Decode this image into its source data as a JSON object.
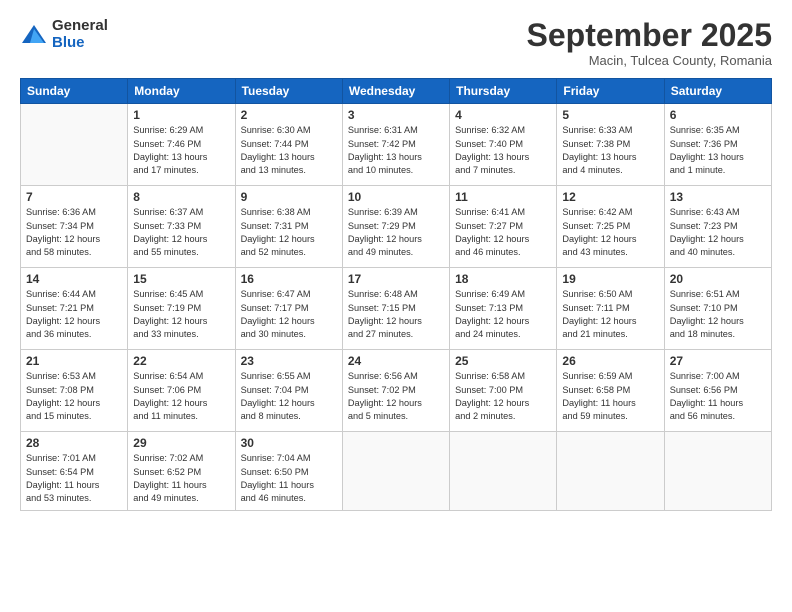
{
  "logo": {
    "general": "General",
    "blue": "Blue"
  },
  "header": {
    "month": "September 2025",
    "location": "Macin, Tulcea County, Romania"
  },
  "weekdays": [
    "Sunday",
    "Monday",
    "Tuesday",
    "Wednesday",
    "Thursday",
    "Friday",
    "Saturday"
  ],
  "weeks": [
    [
      {
        "day": "",
        "info": ""
      },
      {
        "day": "1",
        "info": "Sunrise: 6:29 AM\nSunset: 7:46 PM\nDaylight: 13 hours\nand 17 minutes."
      },
      {
        "day": "2",
        "info": "Sunrise: 6:30 AM\nSunset: 7:44 PM\nDaylight: 13 hours\nand 13 minutes."
      },
      {
        "day": "3",
        "info": "Sunrise: 6:31 AM\nSunset: 7:42 PM\nDaylight: 13 hours\nand 10 minutes."
      },
      {
        "day": "4",
        "info": "Sunrise: 6:32 AM\nSunset: 7:40 PM\nDaylight: 13 hours\nand 7 minutes."
      },
      {
        "day": "5",
        "info": "Sunrise: 6:33 AM\nSunset: 7:38 PM\nDaylight: 13 hours\nand 4 minutes."
      },
      {
        "day": "6",
        "info": "Sunrise: 6:35 AM\nSunset: 7:36 PM\nDaylight: 13 hours\nand 1 minute."
      }
    ],
    [
      {
        "day": "7",
        "info": "Sunrise: 6:36 AM\nSunset: 7:34 PM\nDaylight: 12 hours\nand 58 minutes."
      },
      {
        "day": "8",
        "info": "Sunrise: 6:37 AM\nSunset: 7:33 PM\nDaylight: 12 hours\nand 55 minutes."
      },
      {
        "day": "9",
        "info": "Sunrise: 6:38 AM\nSunset: 7:31 PM\nDaylight: 12 hours\nand 52 minutes."
      },
      {
        "day": "10",
        "info": "Sunrise: 6:39 AM\nSunset: 7:29 PM\nDaylight: 12 hours\nand 49 minutes."
      },
      {
        "day": "11",
        "info": "Sunrise: 6:41 AM\nSunset: 7:27 PM\nDaylight: 12 hours\nand 46 minutes."
      },
      {
        "day": "12",
        "info": "Sunrise: 6:42 AM\nSunset: 7:25 PM\nDaylight: 12 hours\nand 43 minutes."
      },
      {
        "day": "13",
        "info": "Sunrise: 6:43 AM\nSunset: 7:23 PM\nDaylight: 12 hours\nand 40 minutes."
      }
    ],
    [
      {
        "day": "14",
        "info": "Sunrise: 6:44 AM\nSunset: 7:21 PM\nDaylight: 12 hours\nand 36 minutes."
      },
      {
        "day": "15",
        "info": "Sunrise: 6:45 AM\nSunset: 7:19 PM\nDaylight: 12 hours\nand 33 minutes."
      },
      {
        "day": "16",
        "info": "Sunrise: 6:47 AM\nSunset: 7:17 PM\nDaylight: 12 hours\nand 30 minutes."
      },
      {
        "day": "17",
        "info": "Sunrise: 6:48 AM\nSunset: 7:15 PM\nDaylight: 12 hours\nand 27 minutes."
      },
      {
        "day": "18",
        "info": "Sunrise: 6:49 AM\nSunset: 7:13 PM\nDaylight: 12 hours\nand 24 minutes."
      },
      {
        "day": "19",
        "info": "Sunrise: 6:50 AM\nSunset: 7:11 PM\nDaylight: 12 hours\nand 21 minutes."
      },
      {
        "day": "20",
        "info": "Sunrise: 6:51 AM\nSunset: 7:10 PM\nDaylight: 12 hours\nand 18 minutes."
      }
    ],
    [
      {
        "day": "21",
        "info": "Sunrise: 6:53 AM\nSunset: 7:08 PM\nDaylight: 12 hours\nand 15 minutes."
      },
      {
        "day": "22",
        "info": "Sunrise: 6:54 AM\nSunset: 7:06 PM\nDaylight: 12 hours\nand 11 minutes."
      },
      {
        "day": "23",
        "info": "Sunrise: 6:55 AM\nSunset: 7:04 PM\nDaylight: 12 hours\nand 8 minutes."
      },
      {
        "day": "24",
        "info": "Sunrise: 6:56 AM\nSunset: 7:02 PM\nDaylight: 12 hours\nand 5 minutes."
      },
      {
        "day": "25",
        "info": "Sunrise: 6:58 AM\nSunset: 7:00 PM\nDaylight: 12 hours\nand 2 minutes."
      },
      {
        "day": "26",
        "info": "Sunrise: 6:59 AM\nSunset: 6:58 PM\nDaylight: 11 hours\nand 59 minutes."
      },
      {
        "day": "27",
        "info": "Sunrise: 7:00 AM\nSunset: 6:56 PM\nDaylight: 11 hours\nand 56 minutes."
      }
    ],
    [
      {
        "day": "28",
        "info": "Sunrise: 7:01 AM\nSunset: 6:54 PM\nDaylight: 11 hours\nand 53 minutes."
      },
      {
        "day": "29",
        "info": "Sunrise: 7:02 AM\nSunset: 6:52 PM\nDaylight: 11 hours\nand 49 minutes."
      },
      {
        "day": "30",
        "info": "Sunrise: 7:04 AM\nSunset: 6:50 PM\nDaylight: 11 hours\nand 46 minutes."
      },
      {
        "day": "",
        "info": ""
      },
      {
        "day": "",
        "info": ""
      },
      {
        "day": "",
        "info": ""
      },
      {
        "day": "",
        "info": ""
      }
    ]
  ]
}
